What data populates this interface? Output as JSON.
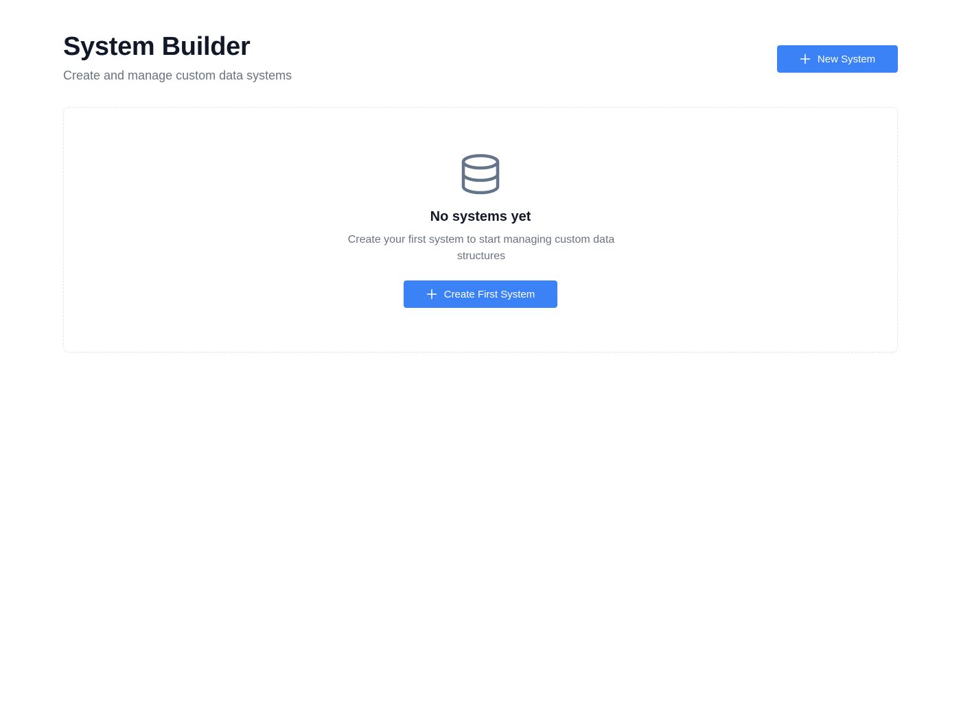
{
  "header": {
    "title": "System Builder",
    "subtitle": "Create and manage custom data systems",
    "new_button_label": "New System",
    "new_button_icon": "plus-icon"
  },
  "empty_state": {
    "icon": "database-icon",
    "title": "No systems yet",
    "description": "Create your first system to start managing custom data structures",
    "create_button_label": "Create First System",
    "create_button_icon": "plus-icon"
  },
  "colors": {
    "accent": "#3b82f6",
    "title_text": "#111827",
    "muted_text": "#6b7280",
    "icon": "#64748b",
    "card_border": "#e5e7eb"
  }
}
